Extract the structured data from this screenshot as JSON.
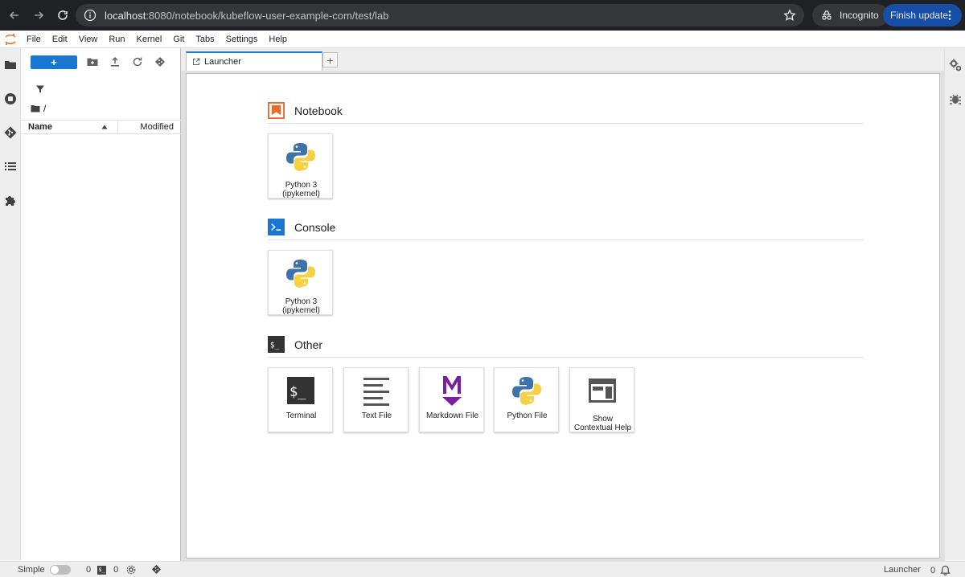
{
  "browser": {
    "url_host": "localhost",
    "url_path": ":8080/notebook/kubeflow-user-example-com/test/lab",
    "incognito_label": "Incognito",
    "finish_update_label": "Finish update"
  },
  "menubar": {
    "items": [
      "File",
      "Edit",
      "View",
      "Run",
      "Kernel",
      "Git",
      "Tabs",
      "Settings",
      "Help"
    ]
  },
  "filebrowser": {
    "new_label": "+",
    "breadcrumb": "/",
    "columns": {
      "name": "Name",
      "modified": "Modified"
    }
  },
  "tabs": [
    {
      "label": "Launcher"
    }
  ],
  "tab_add_label": "+",
  "launcher": {
    "sections": [
      {
        "title": "Notebook",
        "cards": [
          {
            "label": "Python 3\n(ipykernel)",
            "icon": "python-icon"
          }
        ]
      },
      {
        "title": "Console",
        "cards": [
          {
            "label": "Python 3\n(ipykernel)",
            "icon": "python-icon"
          }
        ]
      },
      {
        "title": "Other",
        "cards": [
          {
            "label": "Terminal",
            "icon": "terminal-icon"
          },
          {
            "label": "Text File",
            "icon": "text-file-icon"
          },
          {
            "label": "Markdown File",
            "icon": "markdown-icon"
          },
          {
            "label": "Python File",
            "icon": "python-icon"
          },
          {
            "label": "Show\nContextual Help",
            "icon": "contextual-help-icon"
          }
        ]
      }
    ]
  },
  "statusbar": {
    "simple_label": "Simple",
    "kernels_count": "0",
    "terminals_count": "0",
    "current_activity": "Launcher",
    "notifications_count": "0"
  },
  "colors": {
    "accent": "#1976d2",
    "notebook_icon": "#e46e2e",
    "console_icon": "#1976d2",
    "markdown_icon": "#7b1fa2",
    "python_blue": "#3f72a6",
    "python_yellow": "#f8d046"
  }
}
